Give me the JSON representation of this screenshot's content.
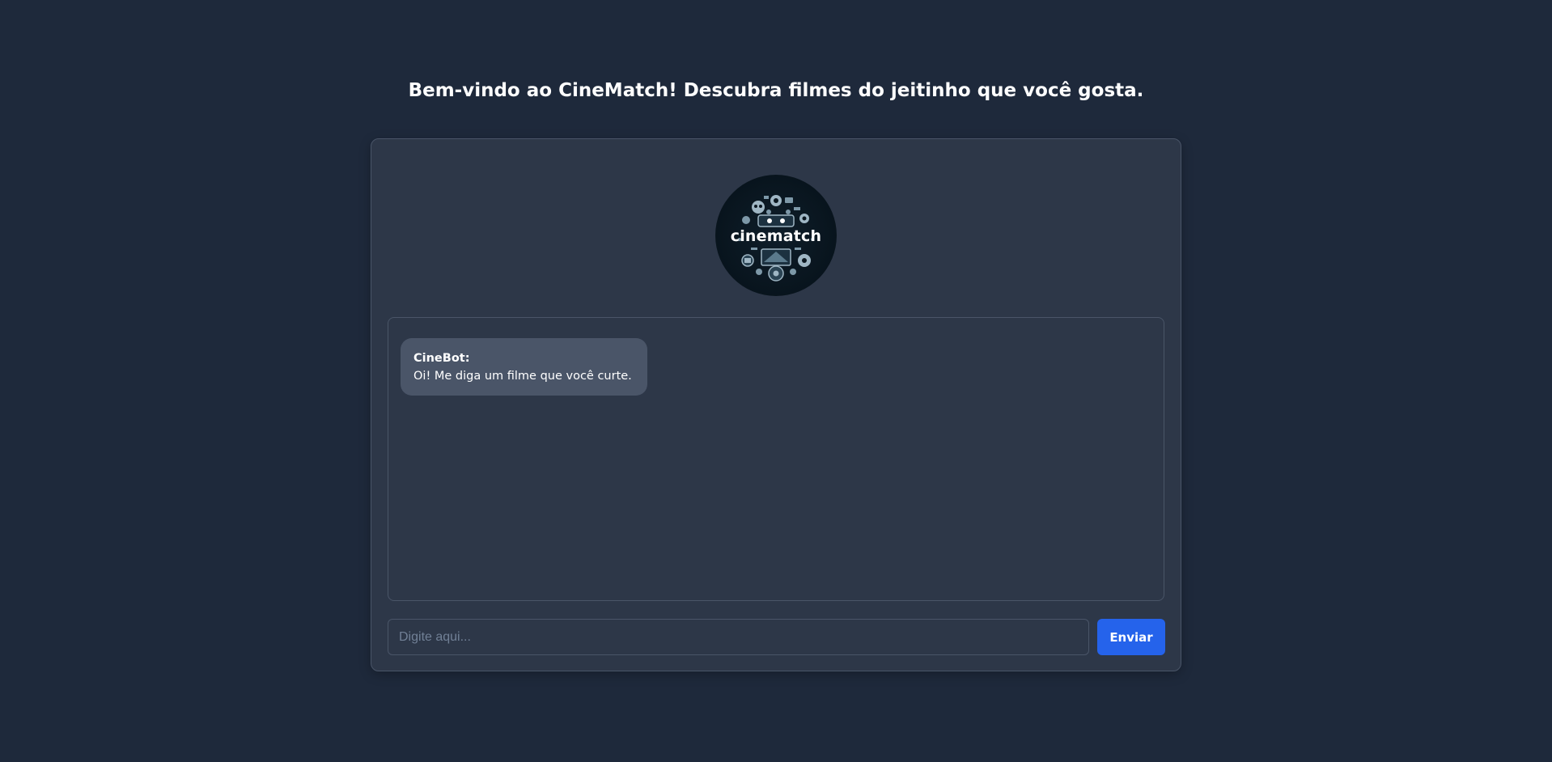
{
  "header": {
    "welcome_text": "Bem-vindo ao CineMatch! Descubra filmes do jeitinho que você gosta."
  },
  "logo": {
    "text": "cinematch",
    "icon": "film-robot-logo"
  },
  "chat": {
    "messages": [
      {
        "sender": "CineBot:",
        "text": "Oi! Me diga um filme que você curte."
      }
    ]
  },
  "input": {
    "placeholder": "Digite aqui...",
    "value": ""
  },
  "send_button": {
    "label": "Enviar"
  },
  "colors": {
    "background": "#1e293b",
    "card": "#2d3748",
    "bubble": "#4a5568",
    "accent": "#2563eb"
  }
}
